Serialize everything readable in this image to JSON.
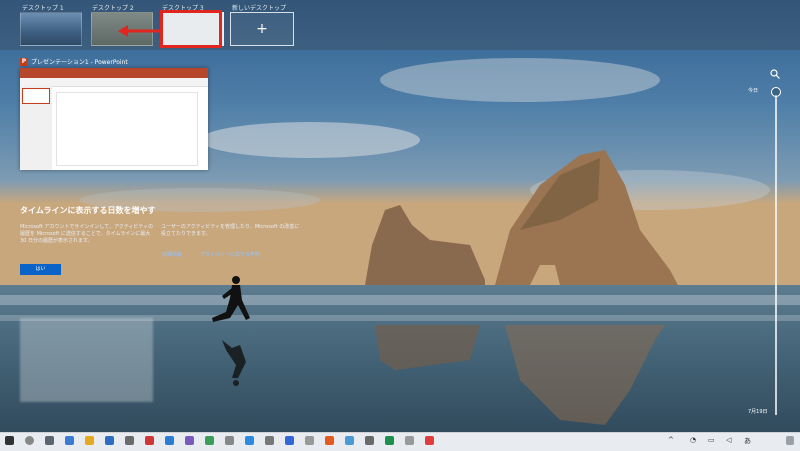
{
  "desktops": [
    {
      "label": "デスクトップ 1"
    },
    {
      "label": "デスクトップ 2"
    },
    {
      "label": "デスクトップ 3"
    },
    {
      "label": "新しいデスクトップ"
    }
  ],
  "window": {
    "title": "プレゼンテーション1 - PowerPoint",
    "app_icon_letter": "P"
  },
  "promo": {
    "title": "タイムラインに表示する日数を増やす",
    "text_left": "Microsoft アカウントでサインインして、アクティビティの履歴を Microsoft に送信することで、タイムラインに最大 30 日分の履歴が表示されます。",
    "text_right": "ユーザーのアクティビティを管理したり、Microsoft の改善に役立てたりできます。",
    "yes_label": "はい",
    "link1": "詳細情報",
    "link2": "プライバシーに関する声明"
  },
  "timeline": {
    "top_label": "今日",
    "bottom_label": "7月19日"
  },
  "colors": {
    "highlight": "#e0261f",
    "accent": "#0a63c6"
  }
}
